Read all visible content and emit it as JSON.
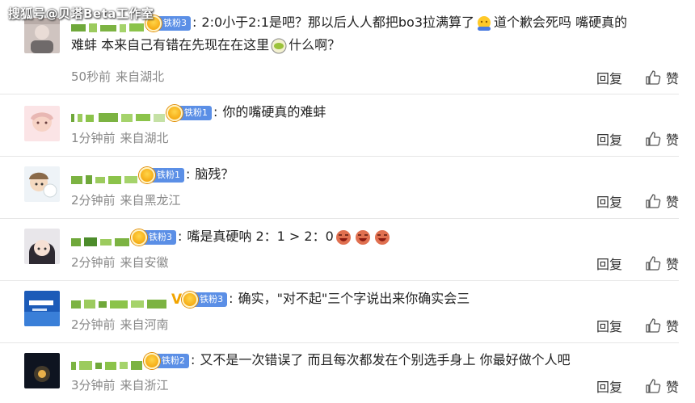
{
  "watermark": "搜狐号@贝塔Beta工作室",
  "labels": {
    "reply": "回复",
    "like": "赞"
  },
  "comments": [
    {
      "badge": "铁粉3",
      "text_a": "2:0小于2:1是吧？那以后人人都把bo3拉满算了",
      "text_b": "道个歉会死吗 嘴硬真的",
      "text_c": "难蚌 本来自己有错在先现在在这里",
      "text_d": "什么啊？",
      "time": "50秒前",
      "location": "来自湖北"
    },
    {
      "badge": "铁粉1",
      "text": "你的嘴硬真的难蚌",
      "time": "1分钟前",
      "location": "来自湖北"
    },
    {
      "badge": "铁粉1",
      "text": "脑残？",
      "time": "2分钟前",
      "location": "来自黑龙江"
    },
    {
      "badge": "铁粉3",
      "text": "嘴是真硬呐 2：1 > 2：0",
      "time": "2分钟前",
      "location": "来自安徽"
    },
    {
      "badge": "铁粉3",
      "text": "确实，\"对不起\"三个字说出来你确实会三",
      "time": "2分钟前",
      "location": "来自河南"
    },
    {
      "badge": "铁粉2",
      "text": "又不是一次错误了 而且每次都发在个别选手身上 你最好做个人吧",
      "time": "3分钟前",
      "location": "来自浙江"
    }
  ]
}
